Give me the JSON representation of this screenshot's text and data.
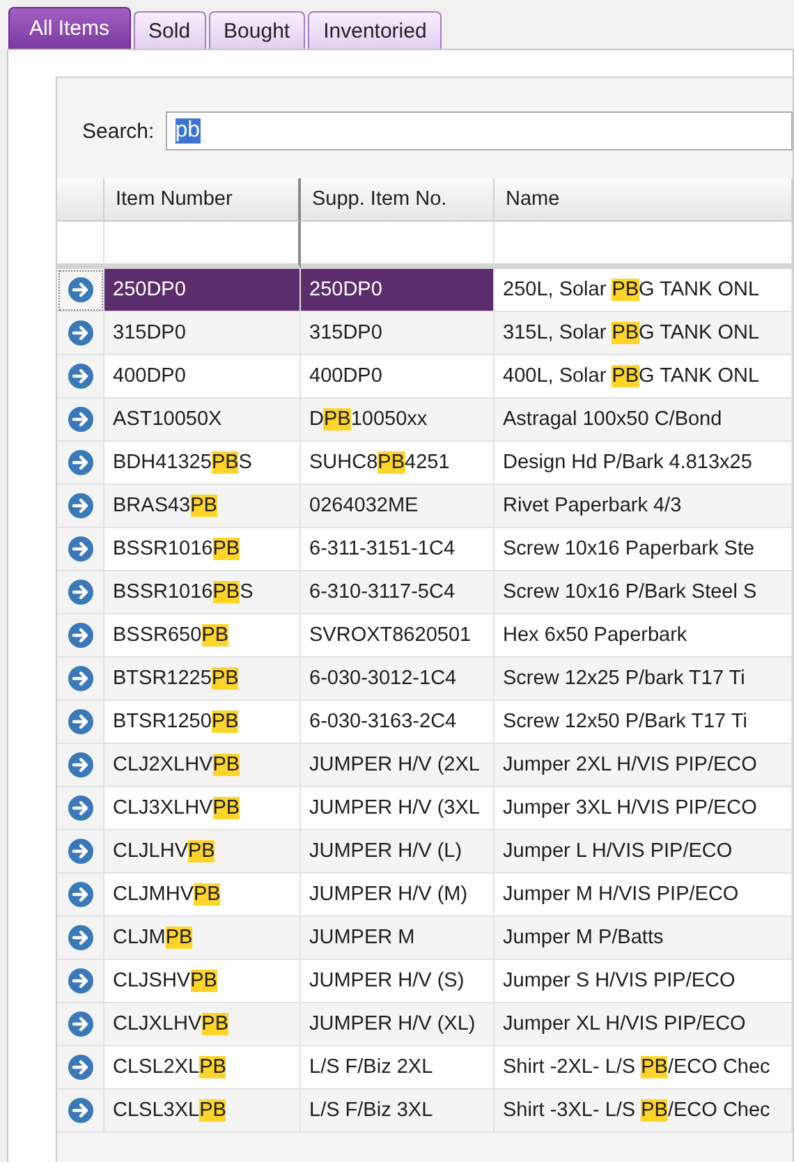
{
  "tabs": [
    {
      "label": "All Items",
      "selected": true
    },
    {
      "label": "Sold",
      "selected": false
    },
    {
      "label": "Bought",
      "selected": false
    },
    {
      "label": "Inventoried",
      "selected": false
    }
  ],
  "search": {
    "label": "Search:",
    "value": "pb",
    "text_selected": true
  },
  "table": {
    "columns": [
      "Item Number",
      "Supp. Item No.",
      "Name"
    ],
    "rows": [
      {
        "selected": true,
        "cells": [
          "250DP0",
          "250DP0",
          "250L, Solar **PB**G TANK ONL"
        ]
      },
      {
        "selected": false,
        "cells": [
          "315DP0",
          "315DP0",
          "315L, Solar **PB**G TANK ONL"
        ]
      },
      {
        "selected": false,
        "cells": [
          "400DP0",
          "400DP0",
          "400L, Solar **PB**G TANK ONL"
        ]
      },
      {
        "selected": false,
        "cells": [
          "AST10050X",
          "D**PB**10050xx",
          "Astragal 100x50 C/Bond"
        ]
      },
      {
        "selected": false,
        "cells": [
          "BDH41325**PB**S",
          "SUHC8**PB**4251",
          "Design Hd P/Bark 4.813x25"
        ]
      },
      {
        "selected": false,
        "cells": [
          "BRAS43**PB**",
          "0264032ME",
          "Rivet Paperbark 4/3"
        ]
      },
      {
        "selected": false,
        "cells": [
          "BSSR1016**PB**",
          "6-311-3151-1C4",
          "Screw 10x16 Paperbark Ste"
        ]
      },
      {
        "selected": false,
        "cells": [
          "BSSR1016**PB**S",
          "6-310-3117-5C4",
          "Screw 10x16 P/Bark Steel S"
        ]
      },
      {
        "selected": false,
        "cells": [
          "BSSR650**PB**",
          "SVROXT8620501",
          "Hex 6x50 Paperbark"
        ]
      },
      {
        "selected": false,
        "cells": [
          "BTSR1225**PB**",
          "6-030-3012-1C4",
          "Screw 12x25 P/bark T17 Ti"
        ]
      },
      {
        "selected": false,
        "cells": [
          "BTSR1250**PB**",
          "6-030-3163-2C4",
          "Screw 12x50 P/Bark T17 Ti"
        ]
      },
      {
        "selected": false,
        "cells": [
          "CLJ2XLHV**PB**",
          "JUMPER H/V (2XL",
          "Jumper 2XL H/VIS PIP/ECO"
        ]
      },
      {
        "selected": false,
        "cells": [
          "CLJ3XLHV**PB**",
          "JUMPER H/V (3XL",
          "Jumper 3XL H/VIS PIP/ECO"
        ]
      },
      {
        "selected": false,
        "cells": [
          "CLJLHV**PB**",
          "JUMPER H/V (L)",
          "Jumper L H/VIS PIP/ECO"
        ]
      },
      {
        "selected": false,
        "cells": [
          "CLJMHV**PB**",
          "JUMPER H/V (M)",
          "Jumper M H/VIS PIP/ECO"
        ]
      },
      {
        "selected": false,
        "cells": [
          "CLJM**PB**",
          "JUMPER M",
          "Jumper M P/Batts"
        ]
      },
      {
        "selected": false,
        "cells": [
          "CLJSHV**PB**",
          "JUMPER H/V (S)",
          "Jumper S H/VIS PIP/ECO"
        ]
      },
      {
        "selected": false,
        "cells": [
          "CLJXLHV**PB**",
          "JUMPER H/V (XL)",
          "Jumper XL H/VIS PIP/ECO"
        ]
      },
      {
        "selected": false,
        "cells": [
          "CLSL2XL**PB**",
          "L/S F/Biz 2XL",
          "Shirt -2XL- L/S **PB**/ECO Chec"
        ]
      },
      {
        "selected": false,
        "cells": [
          "CLSL3XL**PB**",
          "L/S F/Biz 3XL",
          "Shirt -3XL- L/S **PB**/ECO Chec"
        ]
      }
    ]
  }
}
